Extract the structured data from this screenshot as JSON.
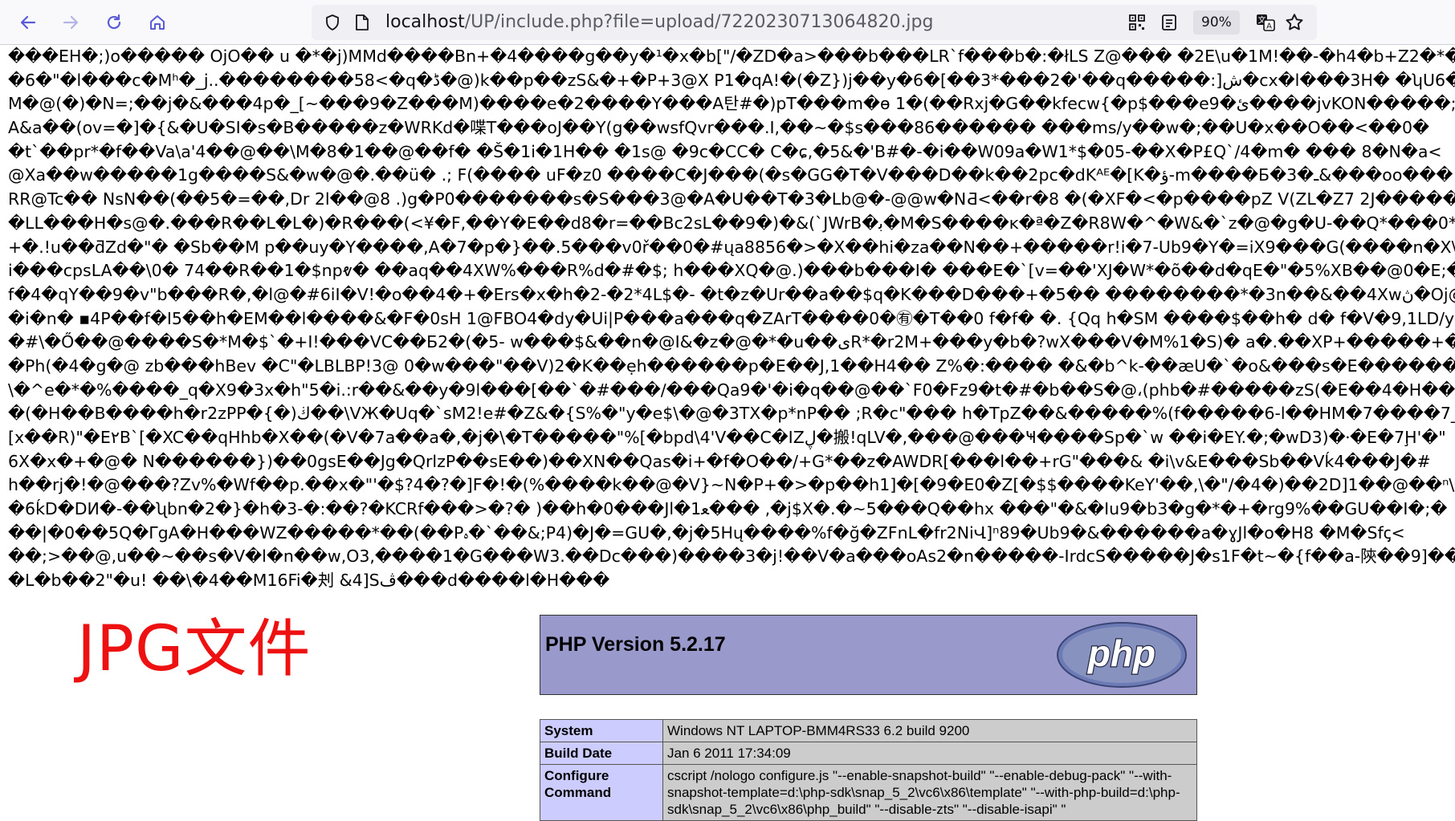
{
  "browser": {
    "url_host": "localhost",
    "url_path": "/UP/include.php?file=upload/7220230713064820.jpg",
    "zoom": "90%"
  },
  "garbled_lines": [
    "���EH�;)o����� OjO�� u �*�j)MMd����Bn+�4����g��y�¹�x�b[\"/�ZD�a>���b���LR`f���b�:�łLS Z@��� �2E\\u�1M!��-�h4�b+Z2�*�9�",
    "�6�\"�l���c�Mʰ�_j..��������58<�q�ڈ�@)k��p��zS&�+�P+3@X P1�qA!�(�Z})j��y�6�[��3*���2�'��q�����:]ش�cx�l���3H� �ʮU6�T",
    "M�@(�)�N=;��j�&���4p�_[~���9�Z���M)����e�2����Y���A탄#�)pT���m�ɵ 1�(��Rxj�G��kfecw{�p$���e9�ئ����jvKON�����;�E",
    "A&a��(ov=�]�{&�U�SI�s�B�����z�WRKd�喋T���oJ��Y(g��wsfQvr���.I,��~�$s���86������ ���ms/y��w�;��U�x��O��<��0�",
    "�t`��pr*�f��Va\\a'4��@��\\M�8�1��@��f� �Š�1i�1H�� �1s@ �9c�CC� C�ɕ,�5&�'B#�-�i��W09a�W1*$�05-��X�P£Q`/4�m� ��� 8�N�a<",
    "@Xa��w�����1g����S&�w�@�.��ü� .; F(���� uF�z0 ����C�J���(�s�GG�T�V���D��k��2pc�dKᴬᴱ�[K�ؤ-m����Ƃ�3�ـ&���oo��� �",
    "RR@Tc�� NsN��(��5�=��,Dr 2l��@8 .)g�P0�������s�S���3@�A�U��T�3�Lb@�-@@w�NƋ<��r�8 �(�XF�<�p����pZ V(ZL�Z7 2J�����@",
    "�LL���H�s@�.���R��L�L�)�R���(<¥�F,��Y�E��d8�r=��Bc2sL��9�)�&(`JWrB�ﺑ�M�S����ĸ�ª�Z�R8W�^�W&�`z�@�g�U-��Q*���0*�",
    "+�.!u��ƌZd�\"� �Sb��M p��uy�Y����,A�7�p�}��.5���v0ř��0�#ųa8856�>�X��hi�za��N��+�����r!i�7-Ub9�Y�=iX9���G(����n�X\\Ä",
    "i���cpsLA��\\0� 74��R��1�$npⱴ� ��aq��4XW%���R%d�#�$; h���XQ�@.)���b���I� ���E�`[v=��'XJ�W*�õ��d�qE�\"�5%XB��@0�E;�",
    "f�4�qY��9�v\"b���R�,�l@�#6iI�V!�o��4�+�Ers�x�h�2-�2*4L$�- �t�z�Ur��a��$q�K���D���+�5�� ��������*�3n��&��4Xwڽ�Oj@K",
    "�i�n� ▪4P��f�I5��h�EM��l����&�F�0sH 1@FBO4�dy�Ui|P���a���q�ZArT����0�㊒�T��0 f�f� �. {Qq h�SM ����$��h� d� f�V�9,1LD/yu",
    "�#\\�Ő��@����S�*M�$`�+I!���VC��Б2�(�5- w���$&��n�@I&�z�@�*�u��ىR*�r2M+���y�b�?wX���V�M%1�S)� a�.��XP+�����+�N",
    "�Ph(�4�g�@ zb���hBev �C\"�LBLBP!3@ 0�w���\"��V)2�K��ẹh������p�E��J,1��H4�� Z%�:���� �&�b^k-��æU�`�o&���s�E������",
    "\\�^e�*�%����_q�X9�3x�h\"5�i.:r��&��y�9l���[��`�#���/���Qa9�'�i�q��@��`F0�Fz9�t�#�b��S�@،(phb�#�����zS(�E��4�H���н",
    "�(�H��B����h�r2zPP�{�)ڬ��\\VЖ�Uq�`sM2!e#�Z&�{S%�\"y�e$\\�@�3TX�p*nP�� ;R�c\"��� h�TpZ��&�����%(f�����6-l��HM�7����7_AA",
    "[x��R)\"�E٢B`[�XC��qHhb�X��(�V�7a��a�,�j�\\�T�����\"%[�bpd\\4'V��C�IZڸ�搬!qLV�,���@���Ҹ����Sp�`w ��i�EY.�;�wD3)�⸱�E�7Ḩ'�\"",
    "6X�x�+�@� N������})��0gsE��Jg�QrlzP��sE��)��XN��Qas�i+�f�O��/+G*��z�AWDR[���l��+rG\"���& �i\\v&E���Sb��Vḱ4���J�#",
    "h��rj�!�@���?Zv%�Wf��p.��x�\"'�$?4�?�]F�!�(%����k��@�V}~N�P+�>�p��h1]�[�9�E0�Z[�$$����KeY'��,\\�\"/�4�)��2D]1��@��ⁿ\\�",
    "�6ḱD�DИ�-��ʯbn�2�}�h�3-�:��?�KCRf���>�?� )��h�0���Jl�1ﻌ��� ,�j$X�.�~5���Q��hx ���\"�&�Iu9�b3�g�*�+�rg9%��GU��I�;�",
    "��|�0��5Q�ΓgA�H���WZ�����*��(��Pﮦ�`��&;P4)�J�=GU�,�j�5Hų����%f�ğ�ZFnL�fr2NiՎ]ⁿ89�Ub9�&������a�ɣJl�o�H8 �M�Sfꞔ<",
    "��;>��@,u��~��s�V�l�n��w,O3,����1�G���W3.��Dc���)����3�j!��V�a���oAs2�n�����-IrdcS�����J�s1F�t~�{f��a-陝��9]���",
    "�L�b��2\"�u! ��\\�4��M16Fi�刔 &4]Sڤ���d����l�H���"
  ],
  "overlay_label": "JPG文件",
  "php_header": {
    "version": "PHP Version 5.2.17",
    "logo_text": "php"
  },
  "php_table": {
    "rows": [
      {
        "key": "System",
        "value": "Windows NT LAPTOP-BMM4RS33 6.2 build 9200"
      },
      {
        "key": "Build Date",
        "value": "Jan 6 2011 17:34:09"
      },
      {
        "key": "Configure Command",
        "value": "cscript /nologo configure.js \"--enable-snapshot-build\" \"--enable-debug-pack\" \"--with-snapshot-template=d:\\php-sdk\\snap_5_2\\vc6\\x86\\template\" \"--with-php-build=d:\\php-sdk\\snap_5_2\\vc6\\x86\\php_build\" \"--disable-zts\" \"--disable-isapi\" \""
      }
    ]
  }
}
